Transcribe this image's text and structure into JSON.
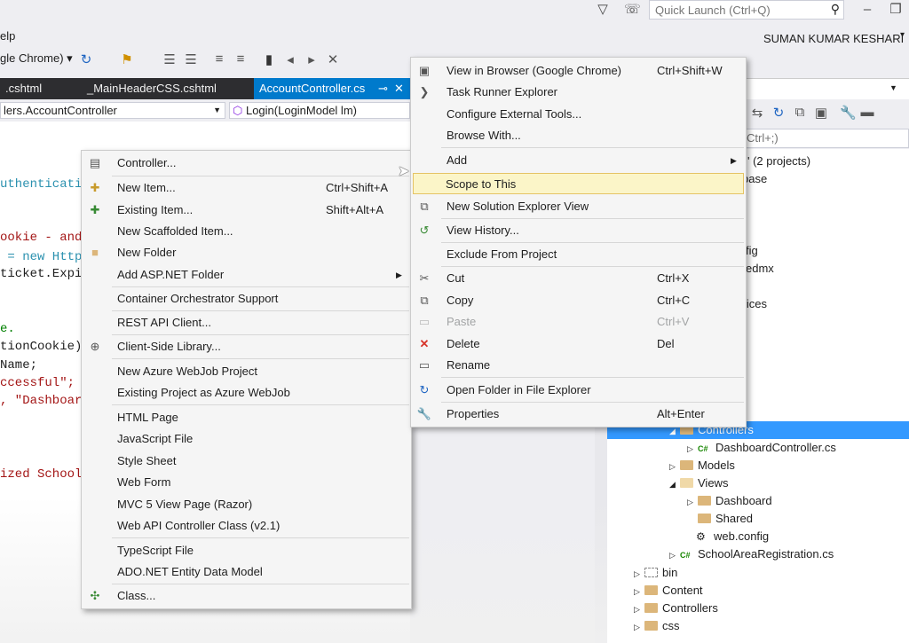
{
  "window": {
    "help_menu": "elp",
    "quick_launch_placeholder": "Quick Launch (Ctrl+Q)",
    "user_name": "SUMAN KUMAR KESHARI"
  },
  "toolbar": {
    "browser": "gle Chrome) ▾"
  },
  "tabs": [
    {
      "label": ".cshtml"
    },
    {
      "label": "_MainHeaderCSS.cshtml"
    },
    {
      "label": "AccountController.cs"
    }
  ],
  "nav": {
    "type_combo": "lers.AccountController",
    "member_combo": "Login(LoginModel lm)"
  },
  "code_lines": [
    "uthenticati",
    "ookie - and",
    " = new Http",
    "ticket.Expi",
    "e.",
    "tionCookie)",
    "Name;",
    "ccessful\";",
    ", \"Dashboar",
    "ized School"
  ],
  "solution_explorer": {
    "search_placeholder": "Ctrl+;)",
    "items": [
      {
        "label": "' (2 projects)"
      },
      {
        "label": "base"
      },
      {
        "label": "fig"
      },
      {
        "label": "edmx"
      },
      {
        "label": "rvices"
      },
      {
        "label": "Controllers"
      },
      {
        "label": "DashboardController.cs"
      },
      {
        "label": "Models"
      },
      {
        "label": "Views"
      },
      {
        "label": "Dashboard"
      },
      {
        "label": "Shared"
      },
      {
        "label": "web.config"
      },
      {
        "label": "SchoolAreaRegistration.cs"
      },
      {
        "label": "bin"
      },
      {
        "label": "Content"
      },
      {
        "label": "Controllers"
      },
      {
        "label": "css"
      }
    ]
  },
  "add_menu": {
    "items": [
      {
        "label": "Controller...",
        "shortcut": ""
      },
      {
        "label": "New Item...",
        "shortcut": "Ctrl+Shift+A"
      },
      {
        "label": "Existing Item...",
        "shortcut": "Shift+Alt+A"
      },
      {
        "label": "New Scaffolded Item...",
        "shortcut": ""
      },
      {
        "label": "New Folder",
        "shortcut": ""
      },
      {
        "label": "Add ASP.NET Folder",
        "shortcut": ""
      },
      {
        "label": "Container Orchestrator Support",
        "shortcut": ""
      },
      {
        "label": "REST API Client...",
        "shortcut": ""
      },
      {
        "label": "Client-Side Library...",
        "shortcut": ""
      },
      {
        "label": "New Azure WebJob Project",
        "shortcut": ""
      },
      {
        "label": "Existing Project as Azure WebJob",
        "shortcut": ""
      },
      {
        "label": "HTML Page",
        "shortcut": ""
      },
      {
        "label": "JavaScript File",
        "shortcut": ""
      },
      {
        "label": "Style Sheet",
        "shortcut": ""
      },
      {
        "label": "Web Form",
        "shortcut": ""
      },
      {
        "label": "MVC 5 View Page (Razor)",
        "shortcut": ""
      },
      {
        "label": "Web API Controller Class (v2.1)",
        "shortcut": ""
      },
      {
        "label": "TypeScript File",
        "shortcut": ""
      },
      {
        "label": "ADO.NET Entity Data Model",
        "shortcut": ""
      },
      {
        "label": "Class...",
        "shortcut": ""
      }
    ]
  },
  "context_menu": {
    "items": [
      {
        "label": "View in Browser (Google Chrome)",
        "shortcut": "Ctrl+Shift+W"
      },
      {
        "label": "Task Runner Explorer",
        "shortcut": ""
      },
      {
        "label": "Configure External Tools...",
        "shortcut": ""
      },
      {
        "label": "Browse With...",
        "shortcut": ""
      },
      {
        "label": "Add",
        "shortcut": ""
      },
      {
        "label": "Scope to This",
        "shortcut": ""
      },
      {
        "label": "New Solution Explorer View",
        "shortcut": ""
      },
      {
        "label": "View History...",
        "shortcut": ""
      },
      {
        "label": "Exclude From Project",
        "shortcut": ""
      },
      {
        "label": "Cut",
        "shortcut": "Ctrl+X"
      },
      {
        "label": "Copy",
        "shortcut": "Ctrl+C"
      },
      {
        "label": "Paste",
        "shortcut": "Ctrl+V"
      },
      {
        "label": "Delete",
        "shortcut": "Del"
      },
      {
        "label": "Rename",
        "shortcut": ""
      },
      {
        "label": "Open Folder in File Explorer",
        "shortcut": ""
      },
      {
        "label": "Properties",
        "shortcut": "Alt+Enter"
      }
    ]
  },
  "colors": {
    "tab_active": "#007acc",
    "selection": "#3399ff",
    "menu_highlight": "#fbf5c8",
    "folder": "#dcb67a"
  }
}
